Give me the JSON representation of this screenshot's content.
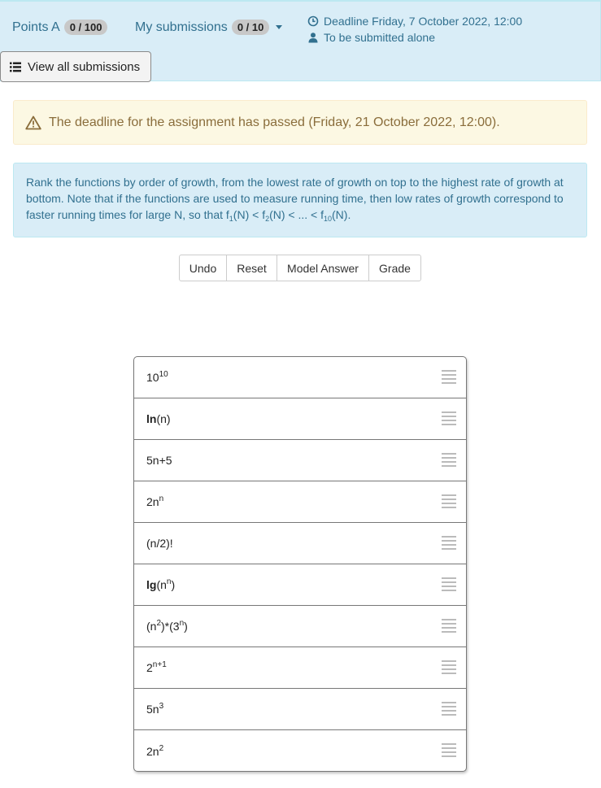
{
  "header": {
    "points_label": "Points A",
    "points_badge": "0 / 100",
    "submissions_label": "My submissions",
    "submissions_badge": "0 / 10",
    "deadline_text": "Deadline Friday, 7 October 2022, 12:00",
    "submit_mode_text": "To be submitted alone",
    "view_all_label": "View all submissions"
  },
  "warning": {
    "text": "The deadline for the assignment has passed (Friday, 21 October 2022, 12:00)."
  },
  "instructions": {
    "text_before": "Rank the functions by order of growth, from the lowest rate of growth on top to the highest rate of growth at bottom. Note that if the functions are used to measure running time, then low rates of growth correspond to faster running times for large N, so that ",
    "f": "f",
    "sub1": "1",
    "mid1": "(N) < ",
    "sub2": "2",
    "mid2": "(N) < ... < ",
    "sub10": "10",
    "end": "(N)."
  },
  "buttons": {
    "undo": "Undo",
    "reset": "Reset",
    "model_answer": "Model Answer",
    "grade": "Grade"
  },
  "items": [
    {
      "base": "10",
      "sup": "10"
    },
    {
      "bold": "ln",
      "rest": "(n)"
    },
    {
      "text": "5n+5"
    },
    {
      "base": "2n",
      "sup": "n"
    },
    {
      "text": "(n/2)!"
    },
    {
      "bold": "lg",
      "pre": "(n",
      "sup": "n",
      "post": ")"
    },
    {
      "pre": "(n",
      "sup": "2",
      "mid": ")*(3",
      "sup2": "n",
      "post": ")"
    },
    {
      "base": "2",
      "sup": "n+1"
    },
    {
      "base": "5n",
      "sup": "3"
    },
    {
      "base": "2n",
      "sup": "2"
    }
  ],
  "colors": {
    "info_bg": "#d9edf7",
    "info_text": "#31708f",
    "warning_bg": "#fcf8e3",
    "warning_text": "#8a6d3b"
  },
  "icons": {
    "deadline": "clock-icon",
    "submit_mode": "user-icon",
    "view_all": "list-icon",
    "warning": "warning-triangle-icon",
    "item_handle": "drag-handle-icon"
  }
}
